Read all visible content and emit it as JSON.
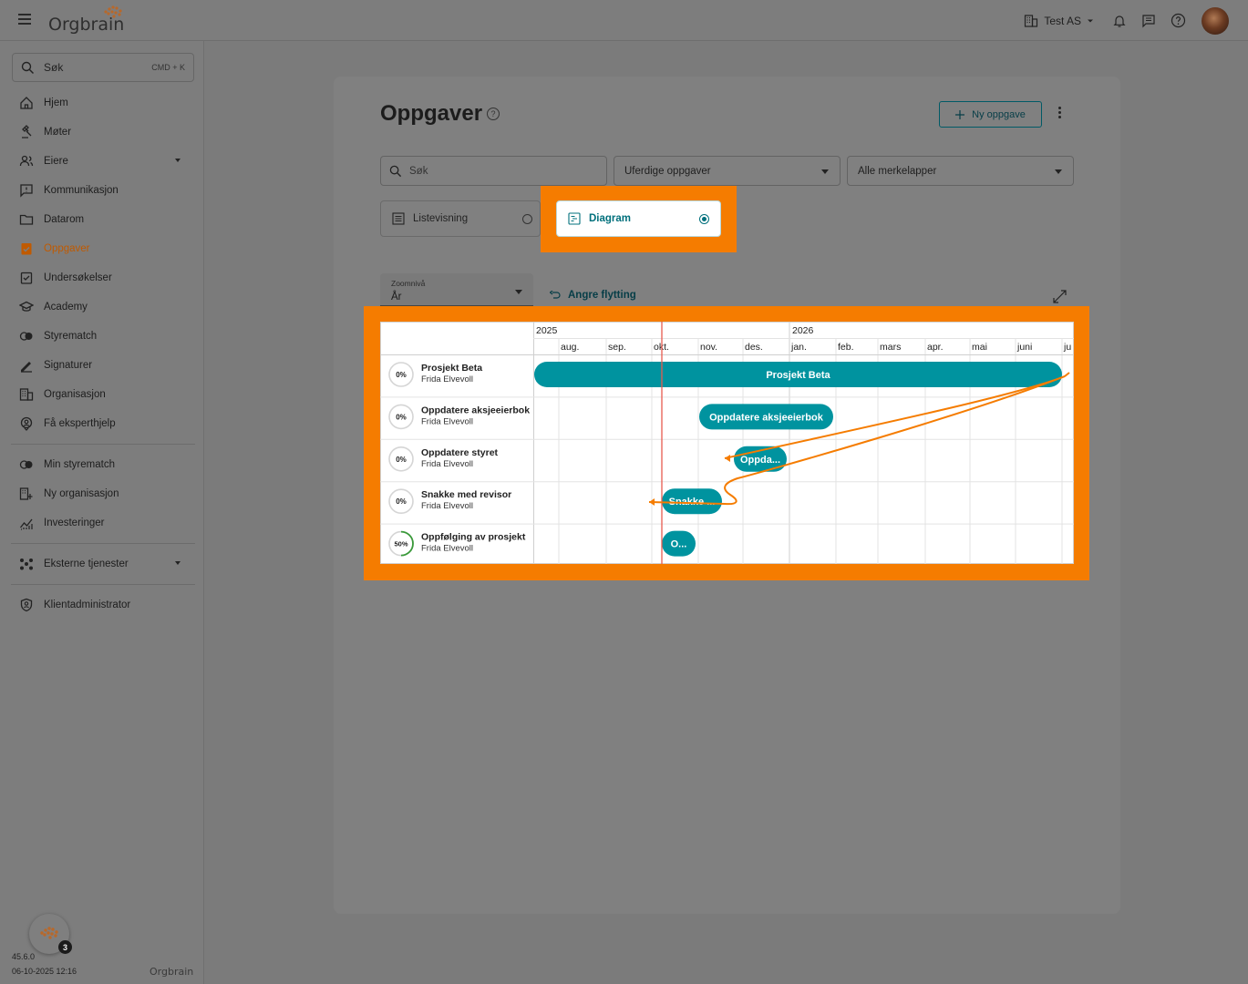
{
  "topbar": {
    "logo_text": "Orgbrain",
    "org_name": "Test AS"
  },
  "sidebar": {
    "search_label": "Søk",
    "search_shortcut": "CMD + K",
    "items": [
      {
        "label": "Hjem",
        "icon": "home-icon"
      },
      {
        "label": "Møter",
        "icon": "gavel-icon"
      },
      {
        "label": "Eiere",
        "icon": "owners-icon",
        "caret": true
      },
      {
        "label": "Kommunikasjon",
        "icon": "message-icon"
      },
      {
        "label": "Datarom",
        "icon": "folder-icon"
      },
      {
        "label": "Oppgaver",
        "icon": "task-icon",
        "active": true
      },
      {
        "label": "Undersøkelser",
        "icon": "survey-icon"
      },
      {
        "label": "Academy",
        "icon": "academy-icon"
      },
      {
        "label": "Styrematch",
        "icon": "match-icon"
      },
      {
        "label": "Signaturer",
        "icon": "signature-icon"
      },
      {
        "label": "Organisasjon",
        "icon": "building-icon"
      },
      {
        "label": "Få eksperthjelp",
        "icon": "expert-icon"
      }
    ],
    "items2": [
      {
        "label": "Min styrematch",
        "icon": "match-icon"
      },
      {
        "label": "Ny organisasjon",
        "icon": "add-building-icon"
      },
      {
        "label": "Investeringer",
        "icon": "chart-icon"
      }
    ],
    "items3": [
      {
        "label": "Eksterne tjenester",
        "icon": "services-icon",
        "caret": true
      }
    ],
    "items4": [
      {
        "label": "Klientadministrator",
        "icon": "shield-icon"
      }
    ],
    "version": "45.6.0",
    "timestamp": "06-10-2025 12:16",
    "help_badge": "3",
    "footer_logo": "Orgbrain"
  },
  "main": {
    "title": "Oppgaver",
    "new_button": "Ny oppgave",
    "search_placeholder": "Søk",
    "status_filter": "Uferdige oppgaver",
    "tag_filter": "Alle merkelapper",
    "view_list": "Listevisning",
    "view_diagram": "Diagram",
    "zoom_label": "Zoomnivå",
    "zoom_value": "År",
    "undo_label": "Angre flytting"
  },
  "gantt": {
    "years": [
      "2025",
      "2026"
    ],
    "months": [
      "aug.",
      "sep.",
      "okt.",
      "nov.",
      "des.",
      "jan.",
      "feb.",
      "mars",
      "apr.",
      "mai",
      "juni",
      "ju"
    ],
    "tasks": [
      {
        "name": "Prosjekt Beta",
        "owner": "Frida Elvevoll",
        "progress": "0%",
        "bar_label": "Prosjekt Beta"
      },
      {
        "name": "Oppdatere aksjeeierbok",
        "owner": "Frida Elvevoll",
        "progress": "0%",
        "bar_label": "Oppdatere aksjeeierbok"
      },
      {
        "name": "Oppdatere styret",
        "owner": "Frida Elvevoll",
        "progress": "0%",
        "bar_label": "Oppda..."
      },
      {
        "name": "Snakke med revisor",
        "owner": "Frida Elvevoll",
        "progress": "0%",
        "bar_label": "Snakke ..."
      },
      {
        "name": "Oppfølging av prosjekt",
        "owner": "Frida Elvevoll",
        "progress": "50%",
        "bar_label": "O..."
      }
    ],
    "colors": {
      "bar": "#00939f",
      "today": "#e85a4f",
      "arrow": "#f57c00"
    }
  }
}
